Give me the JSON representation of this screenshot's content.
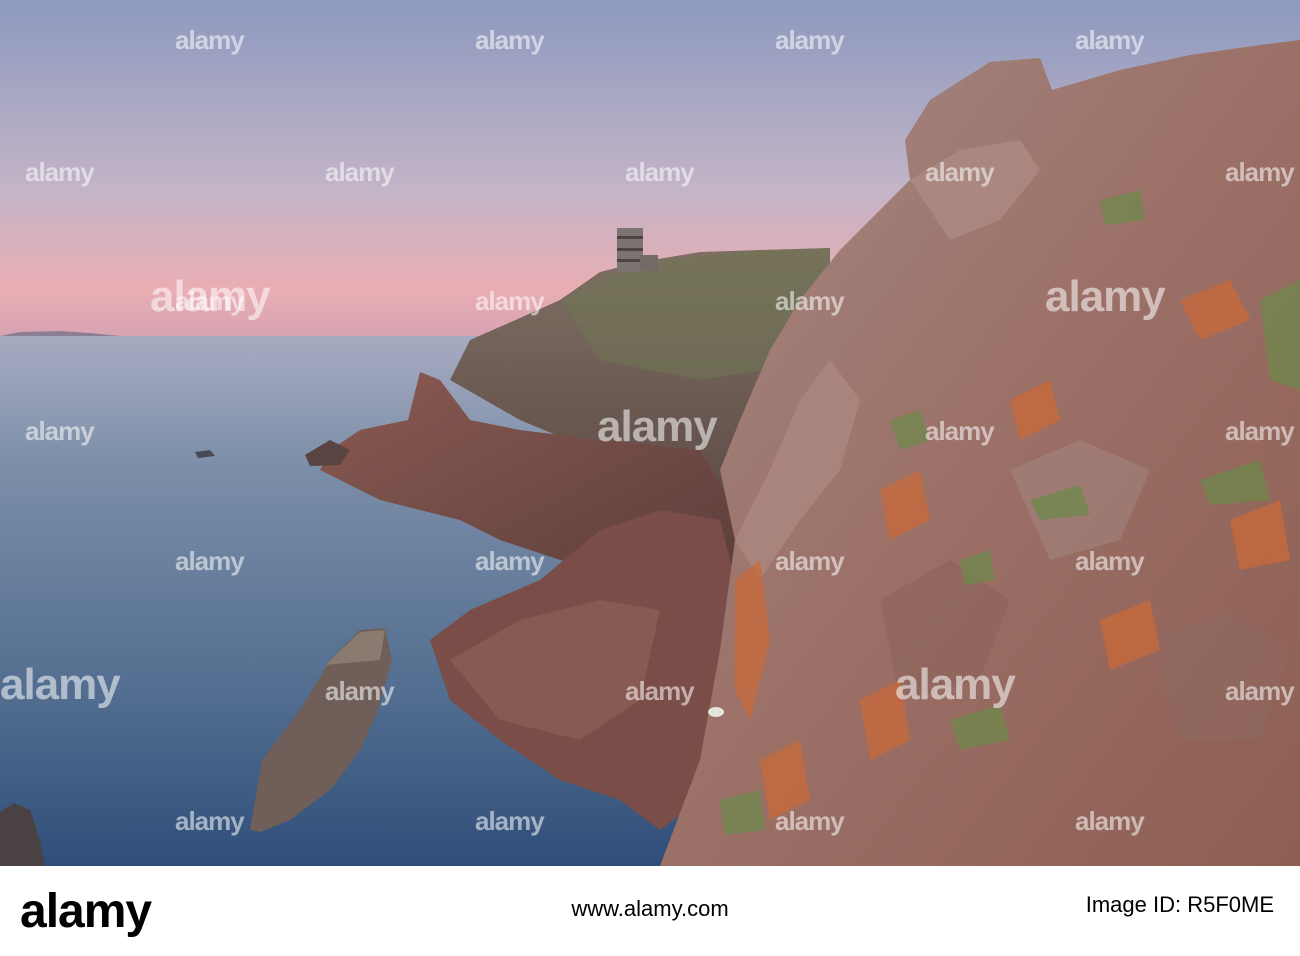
{
  "watermark": {
    "text": "alamy",
    "color": "#ffffff"
  },
  "footer": {
    "logo": "alamy",
    "id_label": "Image ID: R5F0ME",
    "url": "www.alamy.com"
  },
  "colors": {
    "sky_top": "#8f9cc0",
    "sky_horizon": "#e9a9ad",
    "sea": "#4f6e8f",
    "rock": "#9a6e66",
    "lichen": "#c96a3a"
  }
}
